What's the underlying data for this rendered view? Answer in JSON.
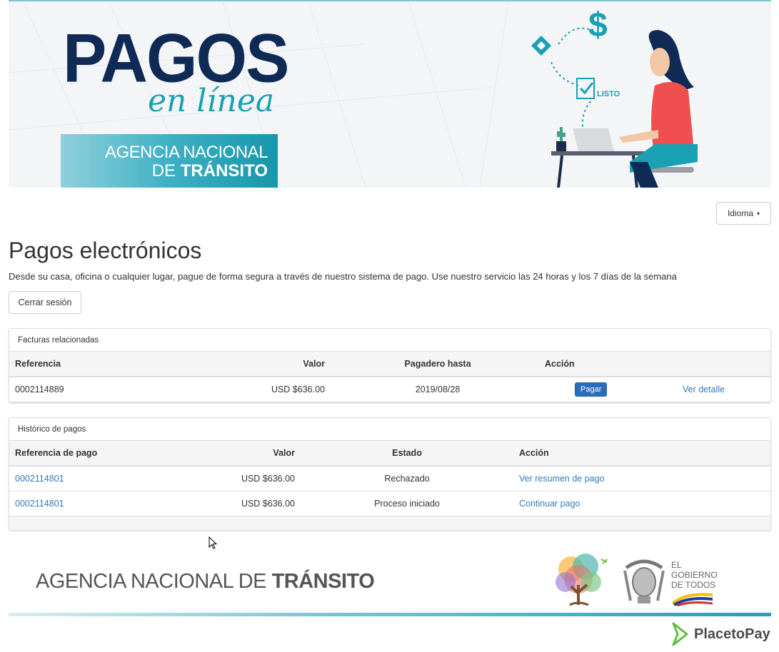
{
  "banner": {
    "brand_big": "PAGOS",
    "brand_sub": "en línea",
    "agency_line1": "AGENCIA NACIONAL",
    "agency_line2_prefix": "DE ",
    "agency_line2_bold": "TRÁNSITO",
    "dollar": "$",
    "listo": "LISTO"
  },
  "idioma": {
    "label": "Idioma"
  },
  "page": {
    "title": "Pagos electrónicos",
    "description": "Desde su casa, oficina o cualquier lugar, pague de forma segura a través de nuestro sistema de pago. Use nuestro servicio las 24 horas y los 7 días de la semana",
    "logout": "Cerrar sesión"
  },
  "invoices": {
    "heading": "Facturas relacionadas",
    "columns": [
      "Referencia",
      "Valor",
      "Pagadero hasta",
      "Acción"
    ],
    "rows": [
      {
        "ref": "0002114889",
        "value": "USD $636.00",
        "due": "2019/08/28",
        "pay": "Pagar",
        "detail": "Ver detalle"
      }
    ]
  },
  "history": {
    "heading": "Histórico de pagos",
    "columns": [
      "Referencia de pago",
      "Valor",
      "Estado",
      "Acción"
    ],
    "rows": [
      {
        "ref": "0002114801",
        "value": "USD $636.00",
        "status": "Rechazado",
        "action": "Ver resumen de pago"
      },
      {
        "ref": "0002114801",
        "value": "USD $636.00",
        "status": "Proceso iniciado",
        "action": "Continuar pago"
      }
    ]
  },
  "footer": {
    "agency_prefix": "AGENCIA NACIONAL DE ",
    "agency_bold": "TRÁNSITO",
    "toda_una_vida": "Toda una Vida",
    "gobierno": [
      "EL",
      "GOBIERNO",
      "DE TODOS"
    ],
    "placetopay": "PlacetoPay"
  },
  "colors": {
    "accent": "#1aa0b3",
    "navy": "#0e2a55",
    "link": "#337ab7",
    "button": "#2a6ebb"
  }
}
